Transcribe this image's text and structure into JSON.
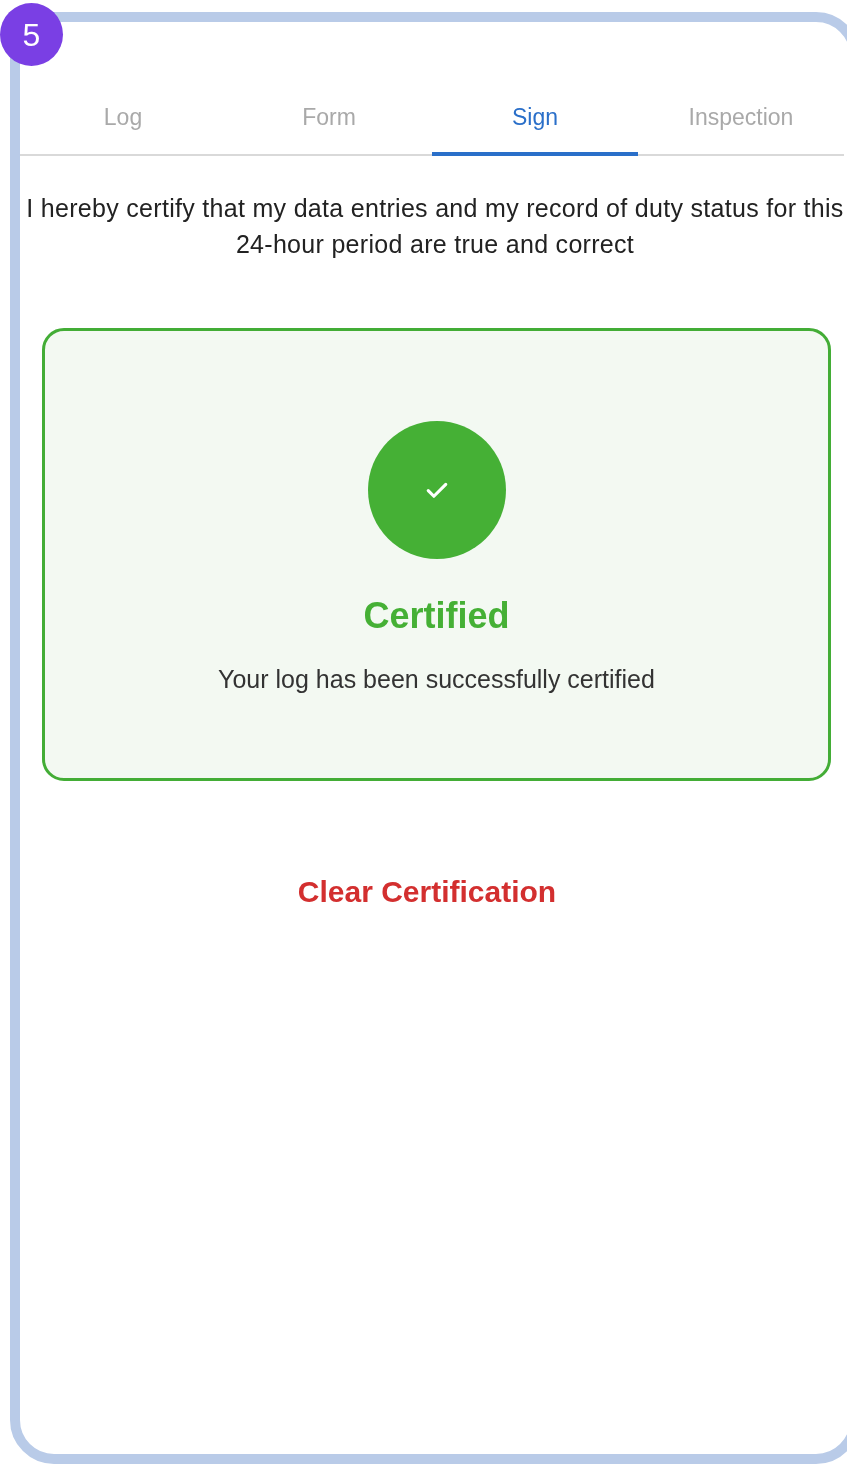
{
  "step_badge": "5",
  "tabs": [
    {
      "label": "Log",
      "selected": false
    },
    {
      "label": "Form",
      "selected": false
    },
    {
      "label": "Sign",
      "selected": true
    },
    {
      "label": "Inspection",
      "selected": false
    }
  ],
  "certification_statement": "I hereby certify that my data entries and my record of duty status for this 24-hour period are true and correct",
  "status_card": {
    "certified": true,
    "title": "Certified",
    "message": "Your log has been successfully certified"
  },
  "clear_button": "Clear Certification"
}
